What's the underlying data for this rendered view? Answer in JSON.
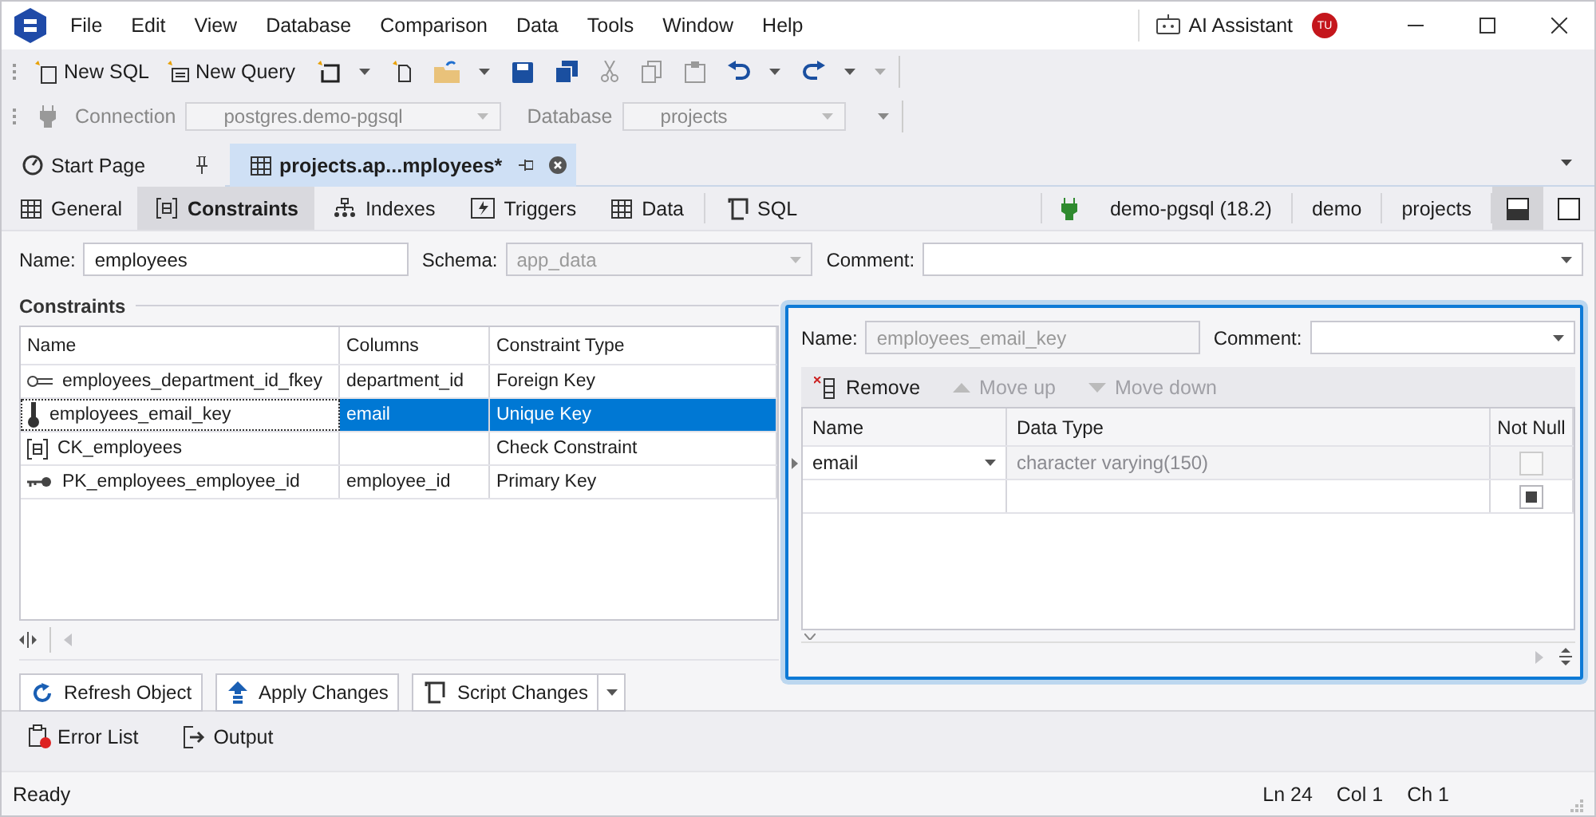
{
  "title_bar": {
    "menu": [
      "File",
      "Edit",
      "View",
      "Database",
      "Comparison",
      "Data",
      "Tools",
      "Window",
      "Help"
    ],
    "ai_assistant": "AI Assistant",
    "avatar_initials": "TU"
  },
  "toolbar": {
    "buttons": [
      {
        "label": "New SQL"
      },
      {
        "label": "New Query"
      }
    ],
    "connection_label": "Connection",
    "connection": "postgres.demo-pgsql",
    "database_label": "Database",
    "database": "projects"
  },
  "document_tabs": [
    {
      "label": "Start Page",
      "selected": false
    },
    {
      "label": "projects.ap...mployees*",
      "selected": true
    }
  ],
  "editor_tabs": [
    {
      "label": "General",
      "kind": "general",
      "selected": false
    },
    {
      "label": "Constraints",
      "kind": "constraints",
      "selected": true
    },
    {
      "label": "Indexes",
      "kind": "indexes",
      "selected": false
    },
    {
      "label": "Triggers",
      "kind": "triggers",
      "selected": false
    },
    {
      "label": "Data",
      "kind": "data",
      "selected": false
    },
    {
      "label": "SQL",
      "kind": "sql",
      "selected": false
    }
  ],
  "connection_info": [
    "demo-pgsql (18.2)",
    "demo",
    "projects"
  ],
  "layout_buttons": [
    {
      "kind": "split",
      "selected": true
    },
    {
      "kind": "single",
      "selected": false
    }
  ],
  "form": {
    "name_label": "Name:",
    "name": "employees",
    "schema_label": "Schema:",
    "schema": "app_data",
    "comment_label": "Comment:"
  },
  "constraints": {
    "title": "Constraints",
    "columns": [
      "Name",
      "Columns",
      "Constraint Type"
    ],
    "rows": [
      {
        "kind": "foreign_key",
        "name": "employees_department_id_fkey",
        "columns": "department_id",
        "type": "Foreign Key",
        "selected": false
      },
      {
        "kind": "unique_key",
        "name": "employees_email_key",
        "columns": "email",
        "type": "Unique Key",
        "selected": true
      },
      {
        "kind": "check",
        "name": "CK_employees",
        "type": "Check Constraint",
        "selected": false
      },
      {
        "kind": "primary_key",
        "name": "PK_employees_employee_id",
        "columns": "employee_id",
        "type": "Primary Key",
        "selected": false
      }
    ]
  },
  "detail": {
    "name_label": "Name:",
    "name": "employees_email_key",
    "comment_label": "Comment:",
    "actions": [
      {
        "label": "Remove",
        "kind": "remove",
        "disabled": false
      },
      {
        "label": "Move up",
        "kind": "up",
        "disabled": true
      },
      {
        "label": "Move down",
        "kind": "down",
        "disabled": true
      }
    ],
    "columns": [
      "Name",
      "Data Type",
      "Not Null"
    ],
    "rows": [
      {
        "name": "email",
        "data_type": "character varying(150)",
        "not_null": false,
        "indeterminate": false,
        "current": true
      },
      {
        "indeterminate": true,
        "current": false
      }
    ]
  },
  "buttons": [
    {
      "label": "Refresh Object",
      "kind": "refresh",
      "dropdown": false
    },
    {
      "label": "Apply Changes",
      "kind": "apply",
      "dropdown": false
    },
    {
      "label": "Script Changes",
      "kind": "script",
      "dropdown": true
    }
  ],
  "bottom_tabs": [
    {
      "label": "Error List",
      "kind": "errors"
    },
    {
      "label": "Output",
      "kind": "output"
    }
  ],
  "status_bar": {
    "text": "Ready",
    "line": "Ln 24",
    "column": "Col 1",
    "char": "Ch 1"
  }
}
